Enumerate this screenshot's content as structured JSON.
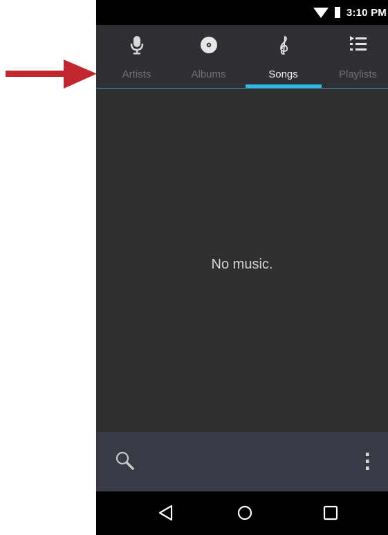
{
  "status_bar": {
    "time": "3:10 PM",
    "icons": [
      "wifi-icon",
      "battery-icon"
    ]
  },
  "tabs": [
    {
      "label": "Artists",
      "icon": "microphone-icon",
      "active": false
    },
    {
      "label": "Albums",
      "icon": "disc-icon",
      "active": false
    },
    {
      "label": "Songs",
      "icon": "treble-clef-icon",
      "active": true
    },
    {
      "label": "Playlists",
      "icon": "playlist-icon",
      "active": false
    }
  ],
  "content": {
    "empty_message": "No music."
  },
  "bottom_bar": {
    "icons": [
      "search-icon",
      "overflow-menu-icon"
    ]
  },
  "nav_bar": {
    "icons": [
      "back-icon",
      "home-icon",
      "recents-icon"
    ]
  },
  "annotation": {
    "icon": "red-arrow-icon",
    "color": "#c1272d"
  },
  "colors": {
    "accent": "#33b5e5",
    "background": "#303030",
    "tab_bar": "#2f3033",
    "bottom_bar": "#363b45"
  }
}
